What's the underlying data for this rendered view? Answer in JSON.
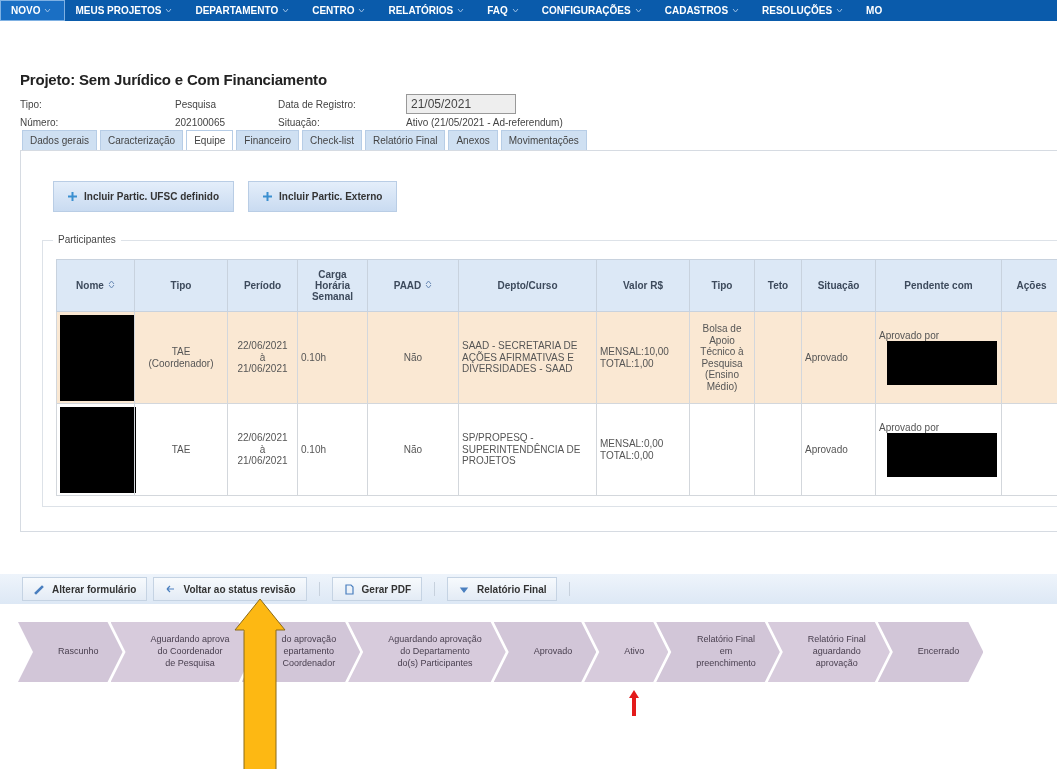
{
  "nav": [
    {
      "label": "NOVO",
      "selected": true,
      "caret": true
    },
    {
      "label": "MEUS PROJETOS",
      "selected": false,
      "caret": true
    },
    {
      "label": "DEPARTAMENTO",
      "selected": false,
      "caret": true
    },
    {
      "label": "CENTRO",
      "selected": false,
      "caret": true
    },
    {
      "label": "RELATÓRIOS",
      "selected": false,
      "caret": true
    },
    {
      "label": "FAQ",
      "selected": false,
      "caret": true
    },
    {
      "label": "CONFIGURAÇÕES",
      "selected": false,
      "caret": true
    },
    {
      "label": "CADASTROS",
      "selected": false,
      "caret": true
    },
    {
      "label": "RESOLUÇÕES",
      "selected": false,
      "caret": true
    },
    {
      "label": "MO",
      "selected": false,
      "caret": false
    }
  ],
  "title": "Projeto: Sem Jurídico e Com Financiamento",
  "info": {
    "tipo_label": "Tipo:",
    "tipo": "Pesquisa",
    "data_label": "Data de Registro:",
    "data": "21/05/2021",
    "numero_label": "Número:",
    "numero": "202100065",
    "situacao_label": "Situação:",
    "situacao": "Ativo (21/05/2021 - Ad-referendum)"
  },
  "tabs": [
    {
      "label": "Dados gerais",
      "selected": false
    },
    {
      "label": "Caracterização",
      "selected": false
    },
    {
      "label": "Equipe",
      "selected": true
    },
    {
      "label": "Financeiro",
      "selected": false
    },
    {
      "label": "Check-list",
      "selected": false
    },
    {
      "label": "Relatório Final",
      "selected": false
    },
    {
      "label": "Anexos",
      "selected": false
    },
    {
      "label": "Movimentações",
      "selected": false
    }
  ],
  "actions": [
    "Incluir Partic. UFSC definido",
    "Incluir Partic. Externo"
  ],
  "fieldset": "Participantes",
  "table": {
    "columns": [
      {
        "label": "Nome",
        "sortable": true
      },
      {
        "label": "Tipo",
        "sortable": false
      },
      {
        "label": "Período",
        "sortable": false
      },
      {
        "label": "Carga Horária Semanal",
        "sortable": false
      },
      {
        "label": "PAAD",
        "sortable": true
      },
      {
        "label": "Depto/Curso",
        "sortable": false
      },
      {
        "label": "Valor R$",
        "sortable": false
      },
      {
        "label": "Tipo",
        "sortable": false
      },
      {
        "label": "Teto",
        "sortable": false
      },
      {
        "label": "Situação",
        "sortable": false
      },
      {
        "label": "Pendente com",
        "sortable": false
      },
      {
        "label": "Ações",
        "sortable": false
      }
    ],
    "rows": [
      {
        "selected": true,
        "tipo": "TAE (Coordenador)",
        "periodo_inicio": "22/06/2021",
        "periodo_sep": "à",
        "periodo_fim": "21/06/2021",
        "carga": "0.10h",
        "paad": "Não",
        "depto": "SAAD - SECRETARIA DE AÇÕES AFIRMATIVAS E DIVERSIDADES - SAAD",
        "valor_mensal": "MENSAL:10,00",
        "valor_total": "TOTAL:1,00",
        "tipo_bolsa": "Bolsa de Apoio Técnico à Pesquisa (Ensino Médio)",
        "situacao": "Aprovado",
        "pendente": "Aprovado por"
      },
      {
        "selected": false,
        "tipo": "TAE",
        "periodo_inicio": "22/06/2021",
        "periodo_sep": "à",
        "periodo_fim": "21/06/2021",
        "carga": "0.10h",
        "paad": "Não",
        "depto": "SP/PROPESQ - SUPERINTENDÊNCIA DE PROJETOS",
        "valor_mensal": "MENSAL:0,00",
        "valor_total": "TOTAL:0,00",
        "situacao": "Aprovado",
        "pendente": "Aprovado por"
      }
    ]
  },
  "toolbar": [
    {
      "label": "Alterar formulário",
      "kind": "edit"
    },
    {
      "label": "Voltar ao status revisão",
      "kind": "back"
    },
    {
      "label": "Gerar PDF",
      "kind": "pdf"
    },
    {
      "label": "Relatório Final",
      "kind": "menu"
    }
  ],
  "steps": [
    {
      "lines": [
        "Rascunho"
      ],
      "current": false
    },
    {
      "lines": [
        "Aguardando aprova",
        "do Coordenador",
        "de Pesquisa"
      ],
      "current": false
    },
    {
      "lines": [
        "do aprovação",
        "epartamento",
        "Coordenador"
      ],
      "current": false
    },
    {
      "lines": [
        "Aguardando aprovação",
        "do Departamento",
        "do(s) Participantes"
      ],
      "current": false
    },
    {
      "lines": [
        "Aprovado"
      ],
      "current": false
    },
    {
      "lines": [
        "Ativo"
      ],
      "current": true
    },
    {
      "lines": [
        "Relatório Final",
        "em",
        "preenchimento"
      ],
      "current": false
    },
    {
      "lines": [
        "Relatório Final",
        "aguardando",
        "aprovação"
      ],
      "current": false
    },
    {
      "lines": [
        "Encerrado"
      ],
      "current": false
    }
  ]
}
